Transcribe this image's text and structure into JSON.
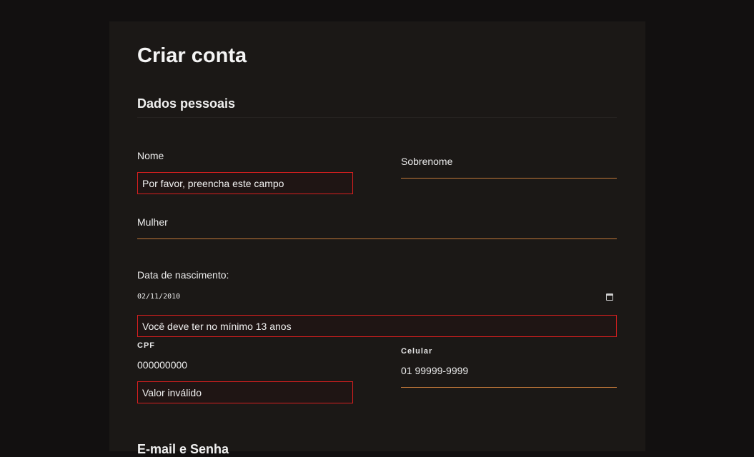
{
  "page": {
    "title": "Criar conta"
  },
  "personal": {
    "section_title": "Dados pessoais",
    "first_name": {
      "label": "Nome",
      "error": "Por favor, preencha este campo"
    },
    "last_name": {
      "label": "Sobrenome"
    },
    "gender": {
      "value": "Mulher"
    },
    "birthdate": {
      "label": "Data de nascimento:",
      "value": "02/11/2010",
      "error": "Você deve ter no mínimo 13 anos"
    },
    "cpf": {
      "label": "CPF",
      "value": "000000000",
      "error": "Valor inválido"
    },
    "phone": {
      "label": "Celular",
      "value": "01 99999-9999"
    }
  },
  "credentials": {
    "section_title": "E-mail e Senha"
  },
  "colors": {
    "background": "#121010",
    "card": "#1b1816",
    "accent_underline": "#c47a3a",
    "error_border": "#d61f1f"
  },
  "icons": {
    "date_picker": "calendar-icon"
  }
}
